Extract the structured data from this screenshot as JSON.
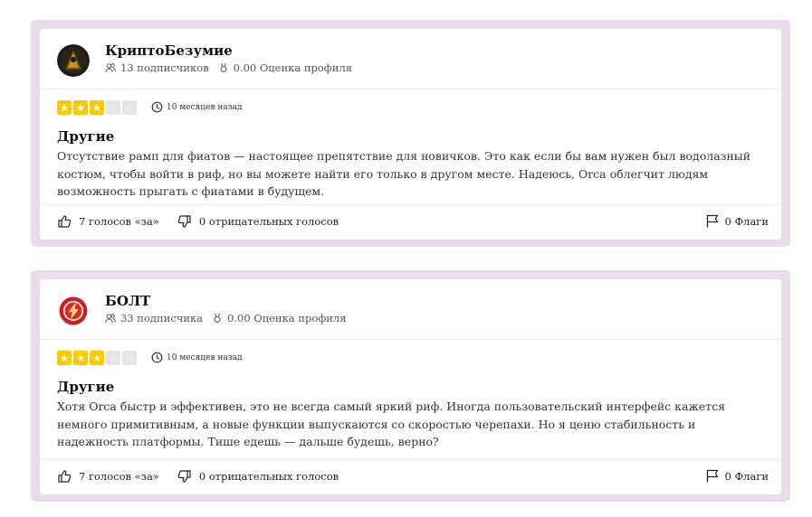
{
  "reviews": [
    {
      "author": "КриптоБезумие",
      "subscribers": "13 подписчиков",
      "profile_score": "0.00 Оценка профиля",
      "rating": 3,
      "time_ago": "10 месяцев назад",
      "title": "Другие",
      "body": "Отсутствие рамп для фиатов — настоящее препятствие для новичков. Это как если бы вам нужен был водолазный костюм, чтобы войти в риф, но вы можете найти его только в другом месте. Надеюсь, Orca облегчит людям возможность прыгать с фиатами в будущем.",
      "upvotes": "7 голосов «за»",
      "downvotes": "0 отрицательных голосов",
      "flags": "0 Флаги",
      "avatar_icon": "dark-hooded-figure-avatar"
    },
    {
      "author": "БОЛТ",
      "subscribers": "33 подписчика",
      "profile_score": "0.00 Оценка профиля",
      "rating": 3,
      "time_ago": "10 месяцев назад",
      "title": "Другие",
      "body": "Хотя Orca быстр и эффективен, это не всегда самый яркий риф. Иногда пользовательский интерфейс кажется немного примитивным, а новые функции выпускаются со скоростью черепахи. Но я ценю стабильность и надежность платформы. Тише едешь — дальше будешь, верно?",
      "upvotes": "7 голосов «за»",
      "downvotes": "0 отрицательных голосов",
      "flags": "0 Флаги",
      "avatar_icon": "red-lightning-bolt-avatar"
    }
  ],
  "colors": {
    "star_active": "#ffc800",
    "star_inactive": "#e5e5e5",
    "card_border": "#e8dcea"
  }
}
